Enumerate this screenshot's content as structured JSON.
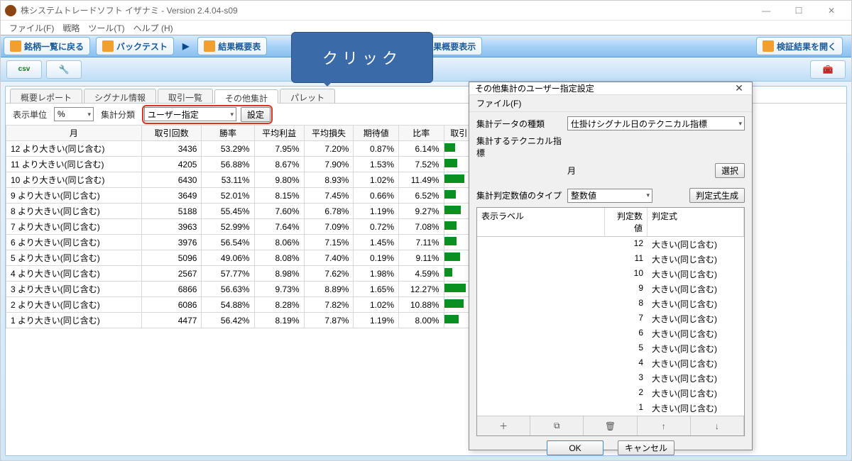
{
  "window": {
    "title": "株システムトレードソフト イザナミ - Version 2.4.04-s09"
  },
  "menu": {
    "file": "ファイル(F)",
    "strategy": "戦略",
    "tool": "ツール(T)",
    "help": "ヘルプ (H)"
  },
  "ribbon": {
    "back": "銘柄一覧に戻る",
    "backtest": "バックテスト",
    "summary1": "結果概要表",
    "summary2": "結果概要表示",
    "open": "検証結果を開く"
  },
  "callout": "クリック",
  "tabs": {
    "t1": "概要レポート",
    "t2": "シグナル情報",
    "t3": "取引一覧",
    "t4": "その他集計",
    "t5": "パレット",
    "t6": "",
    "t7": ""
  },
  "filters": {
    "unit_label": "表示単位",
    "unit_value": "%",
    "group_label": "集計分類",
    "group_value": "ユーザー指定",
    "settings": "設定"
  },
  "columns": {
    "c0": "月",
    "c1": "取引回数",
    "c2": "勝率",
    "c3": "平均利益",
    "c4": "平均損失",
    "c5": "期待値",
    "c6": "比率",
    "c7": "取引"
  },
  "rows": [
    {
      "label": "12 より大きい(同じ含む)",
      "c1": "3436",
      "c2": "53.29%",
      "c3": "7.95%",
      "c4": "7.20%",
      "c5": "0.87%",
      "c6": "6.14%"
    },
    {
      "label": "11 より大きい(同じ含む)",
      "c1": "4205",
      "c2": "56.88%",
      "c3": "8.67%",
      "c4": "7.90%",
      "c5": "1.53%",
      "c6": "7.52%"
    },
    {
      "label": "10 より大きい(同じ含む)",
      "c1": "6430",
      "c2": "53.11%",
      "c3": "9.80%",
      "c4": "8.93%",
      "c5": "1.02%",
      "c6": "11.49%"
    },
    {
      "label": "9 より大きい(同じ含む)",
      "c1": "3649",
      "c2": "52.01%",
      "c3": "8.15%",
      "c4": "7.45%",
      "c5": "0.66%",
      "c6": "6.52%"
    },
    {
      "label": "8 より大きい(同じ含む)",
      "c1": "5188",
      "c2": "55.45%",
      "c3": "7.60%",
      "c4": "6.78%",
      "c5": "1.19%",
      "c6": "9.27%"
    },
    {
      "label": "7 より大きい(同じ含む)",
      "c1": "3963",
      "c2": "52.99%",
      "c3": "7.64%",
      "c4": "7.09%",
      "c5": "0.72%",
      "c6": "7.08%"
    },
    {
      "label": "6 より大きい(同じ含む)",
      "c1": "3976",
      "c2": "56.54%",
      "c3": "8.06%",
      "c4": "7.15%",
      "c5": "1.45%",
      "c6": "7.11%"
    },
    {
      "label": "5 より大きい(同じ含む)",
      "c1": "5096",
      "c2": "49.06%",
      "c3": "8.08%",
      "c4": "7.40%",
      "c5": "0.19%",
      "c6": "9.11%"
    },
    {
      "label": "4 より大きい(同じ含む)",
      "c1": "2567",
      "c2": "57.77%",
      "c3": "8.98%",
      "c4": "7.62%",
      "c5": "1.98%",
      "c6": "4.59%"
    },
    {
      "label": "3 より大きい(同じ含む)",
      "c1": "6866",
      "c2": "56.63%",
      "c3": "9.73%",
      "c4": "8.89%",
      "c5": "1.65%",
      "c6": "12.27%"
    },
    {
      "label": "2 より大きい(同じ含む)",
      "c1": "6086",
      "c2": "54.88%",
      "c3": "8.28%",
      "c4": "7.82%",
      "c5": "1.02%",
      "c6": "10.88%"
    },
    {
      "label": "1 より大きい(同じ含む)",
      "c1": "4477",
      "c2": "56.42%",
      "c3": "8.19%",
      "c4": "7.87%",
      "c5": "1.19%",
      "c6": "8.00%"
    }
  ],
  "dialog": {
    "title": "その他集計のユーザー指定設定",
    "file": "ファイル(F)",
    "type_label": "集計データの種類",
    "type_value": "仕掛けシグナル日のテクニカル指標",
    "indicator_label": "集計するテクニカル指標",
    "indicator_value": "月",
    "select_btn": "選択",
    "numtype_label": "集計判定数値のタイプ",
    "numtype_value": "整数値",
    "gen_btn": "判定式生成",
    "list_head": {
      "c1": "表示ラベル",
      "c2": "判定数値",
      "c3": "判定式"
    },
    "list": [
      {
        "v": "12",
        "f": "大きい(同じ含む)"
      },
      {
        "v": "11",
        "f": "大きい(同じ含む)"
      },
      {
        "v": "10",
        "f": "大きい(同じ含む)"
      },
      {
        "v": "9",
        "f": "大きい(同じ含む)"
      },
      {
        "v": "8",
        "f": "大きい(同じ含む)"
      },
      {
        "v": "7",
        "f": "大きい(同じ含む)"
      },
      {
        "v": "6",
        "f": "大きい(同じ含む)"
      },
      {
        "v": "5",
        "f": "大きい(同じ含む)"
      },
      {
        "v": "4",
        "f": "大きい(同じ含む)"
      },
      {
        "v": "3",
        "f": "大きい(同じ含む)"
      },
      {
        "v": "2",
        "f": "大きい(同じ含む)"
      },
      {
        "v": "1",
        "f": "大きい(同じ含む)"
      }
    ],
    "ok": "OK",
    "cancel": "キャンセル"
  }
}
